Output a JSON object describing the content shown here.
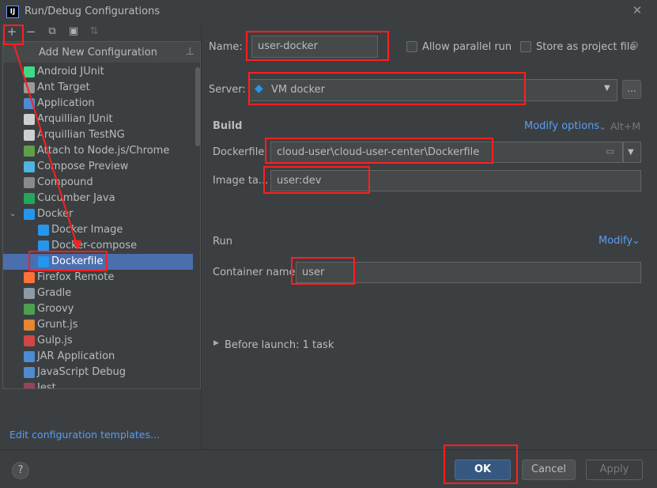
{
  "window": {
    "title": "Run/Debug Configurations",
    "app_icon": "IJ"
  },
  "toolbar": {
    "add": "+",
    "remove": "−",
    "copy": "⧉",
    "folder": "▣",
    "sort": "⇅"
  },
  "popup": {
    "title": "Add New Configuration",
    "items": [
      {
        "label": "Android JUnit",
        "icon_color": "#3ddc84"
      },
      {
        "label": "Ant Target",
        "icon_color": "#9a9a9a"
      },
      {
        "label": "Application",
        "icon_color": "#4e8bd1"
      },
      {
        "label": "Arquillian JUnit",
        "icon_color": "#cfcfcf"
      },
      {
        "label": "Arquillian TestNG",
        "icon_color": "#cfcfcf"
      },
      {
        "label": "Attach to Node.js/Chrome",
        "icon_color": "#5f9f48"
      },
      {
        "label": "Compose Preview",
        "icon_color": "#4eb4e0"
      },
      {
        "label": "Compound",
        "icon_color": "#8a8a8a"
      },
      {
        "label": "Cucumber Java",
        "icon_color": "#23a85b"
      },
      {
        "label": "Docker",
        "icon_color": "#2496ed"
      },
      {
        "label": "Docker Image",
        "icon_color": "#2496ed"
      },
      {
        "label": "Docker-compose",
        "icon_color": "#2496ed"
      },
      {
        "label": "Dockerfile",
        "icon_color": "#2496ed"
      },
      {
        "label": "Firefox Remote",
        "icon_color": "#ff7139"
      },
      {
        "label": "Gradle",
        "icon_color": "#8c9ba5"
      },
      {
        "label": "Groovy",
        "icon_color": "#4c9f50"
      },
      {
        "label": "Grunt.js",
        "icon_color": "#e48632"
      },
      {
        "label": "Gulp.js",
        "icon_color": "#cf4646"
      },
      {
        "label": "JAR Application",
        "icon_color": "#4e8bd1"
      },
      {
        "label": "JavaScript Debug",
        "icon_color": "#4e8bd1"
      },
      {
        "label": "Jest",
        "icon_color": "#99425b"
      }
    ]
  },
  "edit_templates": "Edit configuration templates...",
  "form": {
    "name_label": "Name:",
    "name_value": "user-docker",
    "allow_parallel": "Allow parallel run",
    "store_project": "Store as project file",
    "server_label": "Server:",
    "server_value": "VM docker",
    "server_more": "...",
    "build_title": "Build",
    "modify_options": "Modify options",
    "modify_shortcut": "Alt+M",
    "dockerfile_label": "Dockerfile:",
    "dockerfile_value": "cloud-user\\cloud-user-center\\Dockerfile",
    "image_tag_label": "Image ta...",
    "image_tag_value": "user:dev",
    "run_title": "Run",
    "modify": "Modify",
    "container_label": "Container name:",
    "container_value": "user",
    "before_launch": "Before launch: 1 task"
  },
  "buttons": {
    "help": "?",
    "ok": "OK",
    "cancel": "Cancel",
    "apply": "Apply"
  },
  "colors": {
    "accent": "#4b6eaf",
    "link": "#589df6",
    "highlight": "#ff1f1f"
  }
}
